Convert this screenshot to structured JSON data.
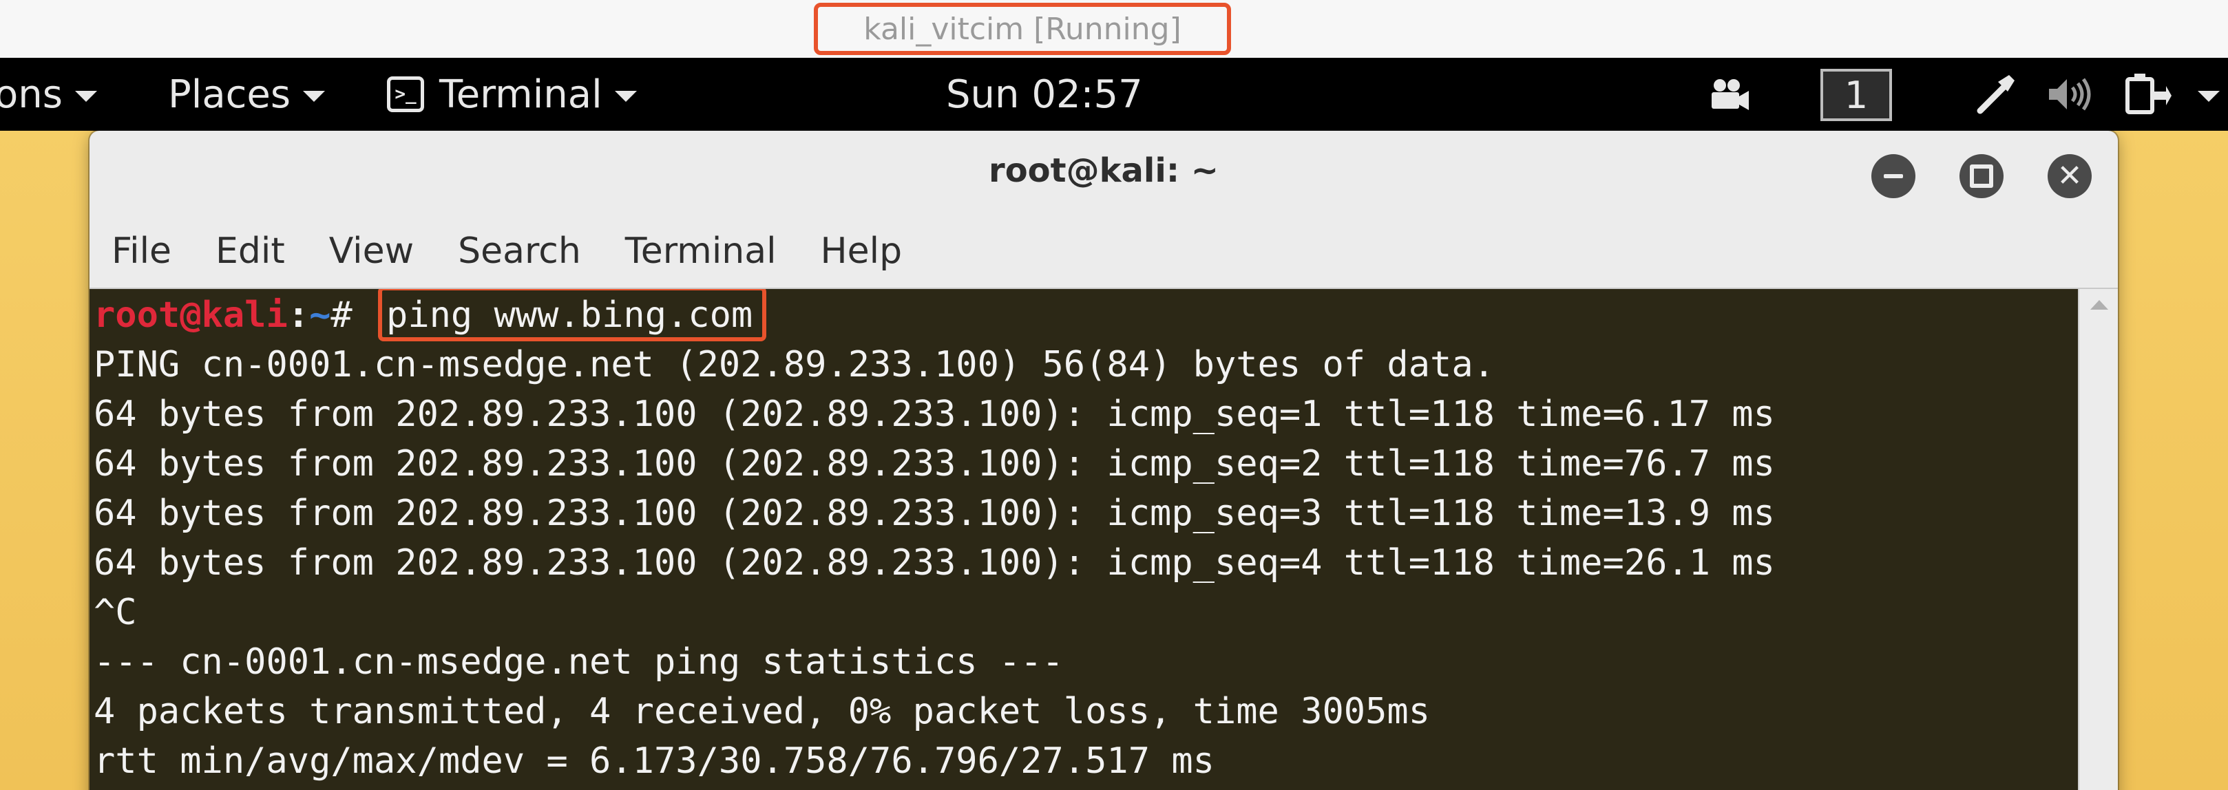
{
  "host": {
    "window_title": "kali_vitcim [Running]"
  },
  "top_bar": {
    "applications_label": "ons",
    "places_label": "Places",
    "terminal_label": "Terminal",
    "clock": "Sun 02:57",
    "workspace": "1",
    "icons": [
      "video-camera-icon",
      "tools-icon",
      "volume-icon",
      "power-icon"
    ]
  },
  "terminal": {
    "title": "root@kali: ~",
    "menu": [
      "File",
      "Edit",
      "View",
      "Search",
      "Terminal",
      "Help"
    ],
    "prompt": {
      "user_host": "root@kali",
      "separator": ":",
      "dir": "~",
      "symbol": "# "
    },
    "command": "ping www.bing.com",
    "output": [
      "PING cn-0001.cn-msedge.net (202.89.233.100) 56(84) bytes of data.",
      "64 bytes from 202.89.233.100 (202.89.233.100): icmp_seq=1 ttl=118 time=6.17 ms",
      "64 bytes from 202.89.233.100 (202.89.233.100): icmp_seq=2 ttl=118 time=76.7 ms",
      "64 bytes from 202.89.233.100 (202.89.233.100): icmp_seq=3 ttl=118 time=13.9 ms",
      "64 bytes from 202.89.233.100 (202.89.233.100): icmp_seq=4 ttl=118 time=26.1 ms",
      "^C",
      "--- cn-0001.cn-msedge.net ping statistics ---",
      "4 packets transmitted, 4 received, 0% packet loss, time 3005ms",
      "rtt min/avg/max/mdev = 6.173/30.758/76.796/27.517 ms"
    ]
  },
  "colors": {
    "annotation_highlight": "#e8532c",
    "terminal_background": "#2c2816",
    "prompt_user": "#e0283a",
    "prompt_dir": "#3d7fd8",
    "desktop_background": "#f2c65e"
  }
}
